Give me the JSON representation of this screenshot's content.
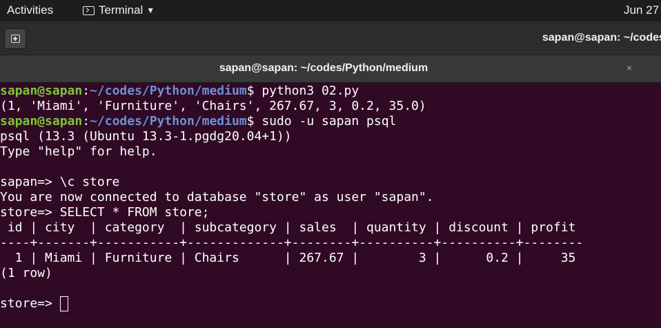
{
  "topbar": {
    "activities": "Activities",
    "app_menu_label": "Terminal",
    "clock": "Jun 27"
  },
  "header": {
    "title": "sapan@sapan: ~/codes"
  },
  "tab": {
    "title": "sapan@sapan: ~/codes/Python/medium",
    "close": "×"
  },
  "terminal": {
    "prompt_user": "sapan@sapan",
    "prompt_path": "~/codes/Python/medium",
    "cmd1": "python3 02.py",
    "out1": "(1, 'Miami', 'Furniture', 'Chairs', 267.67, 3, 0.2, 35.0)",
    "cmd2": "sudo -u sapan psql",
    "psql_version": "psql (13.3 (Ubuntu 13.3-1.pgdg20.04+1))",
    "help_hint": "Type \"help\" for help.",
    "psql_prompt1": "sapan=> ",
    "cmd3": "\\c store",
    "connected_msg": "You are now connected to database \"store\" as user \"sapan\".",
    "psql_prompt2": "store=> ",
    "cmd4": "SELECT * FROM store;",
    "table": {
      "header": " id | city  | category  | subcategory | sales  | quantity | discount | profit",
      "separator": "----+-------+-----------+-------------+--------+----------+----------+--------",
      "rows": [
        "  1 | Miami | Furniture | Chairs      | 267.67 |        3 |      0.2 |     35"
      ],
      "footer": "(1 row)"
    },
    "final_prompt": "store=> "
  }
}
